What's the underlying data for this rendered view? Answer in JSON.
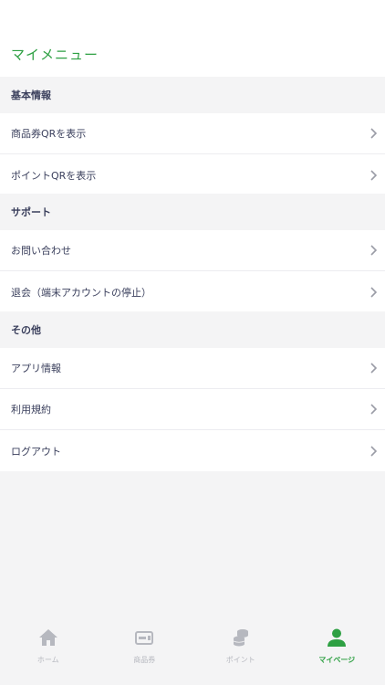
{
  "header": {
    "title": "マイメニュー"
  },
  "sections": [
    {
      "title": "基本情報",
      "items": [
        {
          "label": "商品券QRを表示"
        },
        {
          "label": "ポイントQRを表示"
        }
      ]
    },
    {
      "title": "サポート",
      "items": [
        {
          "label": "お問い合わせ"
        },
        {
          "label": "退会（端末アカウントの停止）"
        }
      ]
    },
    {
      "title": "その他",
      "items": [
        {
          "label": "アプリ情報"
        },
        {
          "label": "利用規約"
        },
        {
          "label": "ログアウト"
        }
      ]
    }
  ],
  "tabbar": {
    "tabs": [
      {
        "label": "ホーム",
        "icon": "home-icon"
      },
      {
        "label": "商品券",
        "icon": "voucher-card-icon"
      },
      {
        "label": "ポイント",
        "icon": "coins-icon"
      },
      {
        "label": "マイページ",
        "icon": "person-icon"
      }
    ],
    "active_index": 3
  },
  "colors": {
    "accent": "#2ea043",
    "inactive": "#b6b8bf",
    "text": "#3a3f5c",
    "background": "#f4f4f5"
  }
}
